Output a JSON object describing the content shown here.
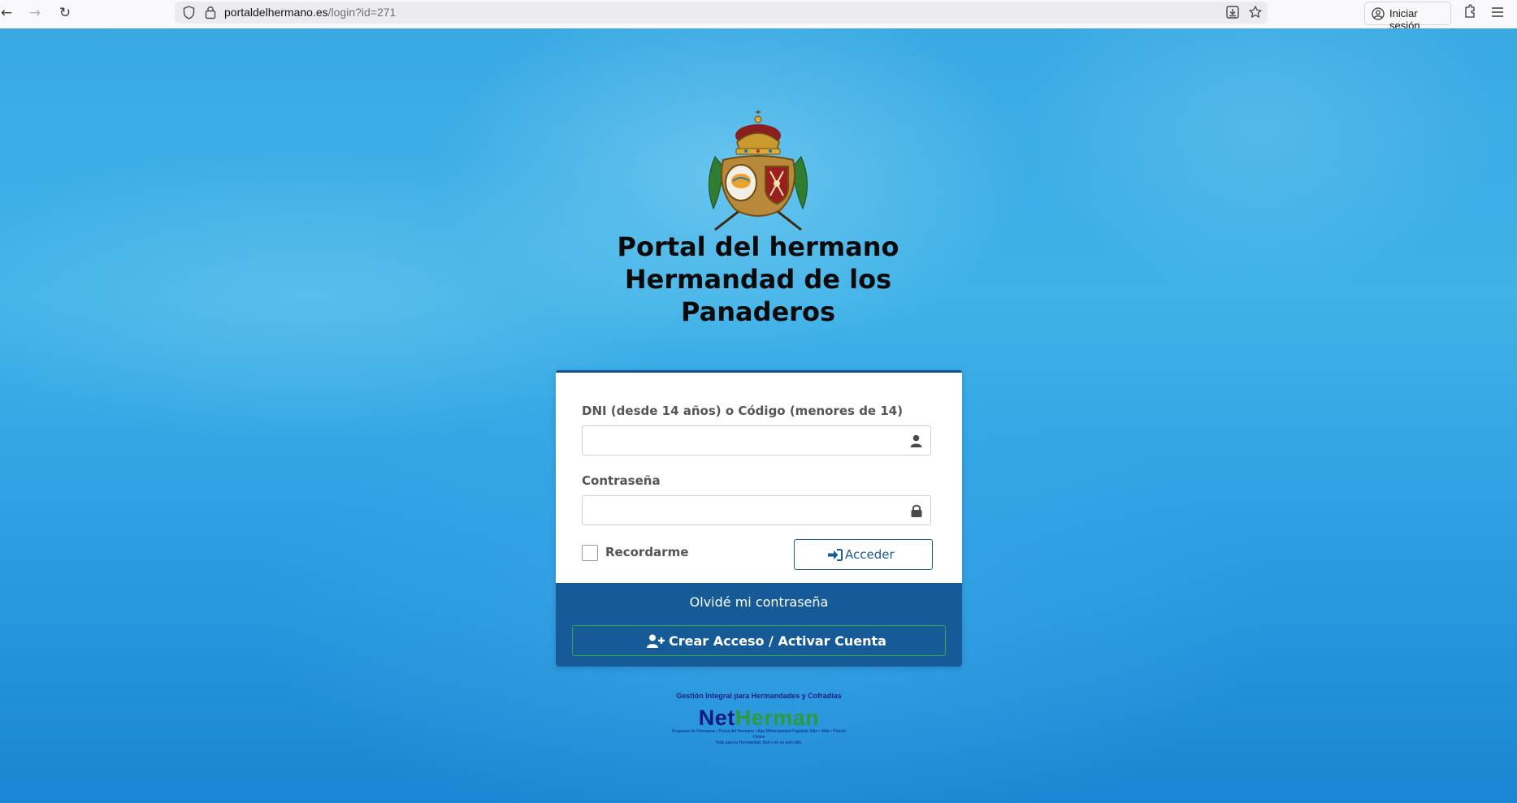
{
  "browser": {
    "url_host": "portaldelhermano.es",
    "url_path": "/login?id=271",
    "signin_label": "Iniciar sesión"
  },
  "header": {
    "title_line1": "Portal del hermano",
    "title_line2": "Hermandad de los",
    "title_line3": "Panaderos"
  },
  "form": {
    "dni_label": "DNI (desde 14 años) o Código (menores de 14)",
    "dni_value": "",
    "password_label": "Contraseña",
    "password_value": "",
    "remember_label": "Recordarme",
    "remember_checked": false,
    "submit_label": "Acceder"
  },
  "footer": {
    "forgot_label": "Olvidé mi contraseña",
    "create_label": "Crear Acceso / Activar Cuenta"
  },
  "brand": {
    "tagline": "Gestión Integral para Hermandades y Cofradías",
    "logo_part1": "Net",
    "logo_part2": "Herman",
    "fine_line1": "Programa de Hermanos • Portal del Hermano • App MiHermandad Papeleta Sitio • Web • Puesto Online",
    "fine_line2": "Todo para tu Hermandad, fácil y en un solo sitio."
  },
  "colors": {
    "accent": "#165a98",
    "create_border": "#2fa84f",
    "brand_blue": "#0d1c7a",
    "brand_green": "#2e9a3b"
  },
  "icons": {
    "dni_field": "user-icon",
    "password_field": "lock-icon",
    "submit": "sign-in-icon",
    "create": "user-plus-icon"
  }
}
